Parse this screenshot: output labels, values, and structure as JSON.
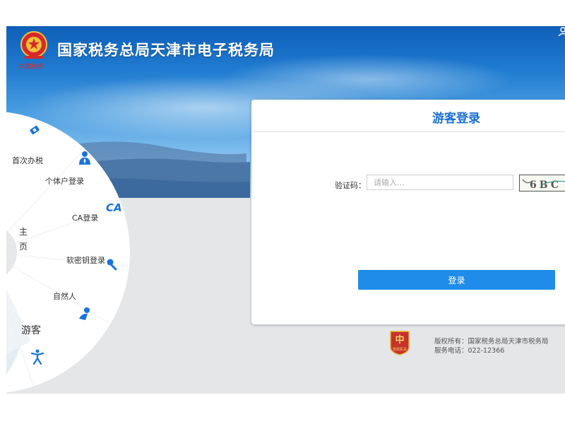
{
  "header": {
    "title": "国家税务总局天津市电子税务局",
    "emblem_caption": "中国税务"
  },
  "wheel": {
    "hub": [
      "主",
      "页"
    ],
    "items": [
      {
        "label": "首次办税",
        "icon": "ticket-icon"
      },
      {
        "label": "个体户登录",
        "icon": "person-tie-icon"
      },
      {
        "label": "CA登录",
        "icon": "ca-icon",
        "icon_text": "CA"
      },
      {
        "label": "软密钥登录",
        "icon": "key-icon"
      },
      {
        "label": "自然人",
        "icon": "person-wave-icon"
      },
      {
        "label": "游客",
        "icon": "visitor-icon",
        "active": true
      }
    ]
  },
  "login": {
    "title": "游客登录",
    "captcha_label": "验证码：",
    "captcha_placeholder": "请输入...",
    "captcha_text": "6BC",
    "submit_label": "登录"
  },
  "footer": {
    "copyright": "版权所有：国家税务总局天津市税务局",
    "phone": "服务电话：022-12366",
    "badge_caption": "党政机关"
  },
  "colors": {
    "accent": "#1e8ce8",
    "title_blue": "#1a6fd0",
    "header_blue": "#1f7bd0"
  }
}
